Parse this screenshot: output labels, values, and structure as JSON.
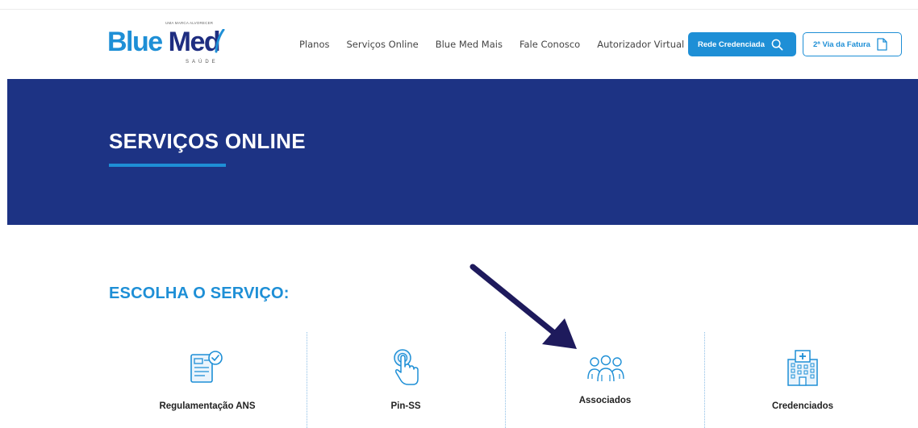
{
  "header": {
    "logo": {
      "tagline": "UMA MARCA ALVORECER",
      "name_part1": "Blue",
      "name_part2": "Med",
      "subtitle": "SAÚDE"
    },
    "nav": [
      {
        "label": "Planos"
      },
      {
        "label": "Serviços Online"
      },
      {
        "label": "Blue Med Mais"
      },
      {
        "label": "Fale Conosco"
      },
      {
        "label": "Autorizador Virtual"
      }
    ],
    "rede_button_label": "Rede Credenciada",
    "fatura_button_label": "2ª Via da Fatura"
  },
  "banner": {
    "title": "SERVIÇOS ONLINE"
  },
  "section": {
    "title": "ESCOLHA O SERVIÇO:"
  },
  "services": [
    {
      "label": "Regulamentação ANS",
      "icon": "document-check-icon"
    },
    {
      "label": "Pin-SS",
      "icon": "touch-icon"
    },
    {
      "label": "Associados",
      "icon": "people-icon"
    },
    {
      "label": "Credenciados",
      "icon": "hospital-icon"
    }
  ],
  "colors": {
    "brand_blue": "#1e8fd6",
    "navy": "#1d3384",
    "arrow": "#1e1a5c"
  }
}
